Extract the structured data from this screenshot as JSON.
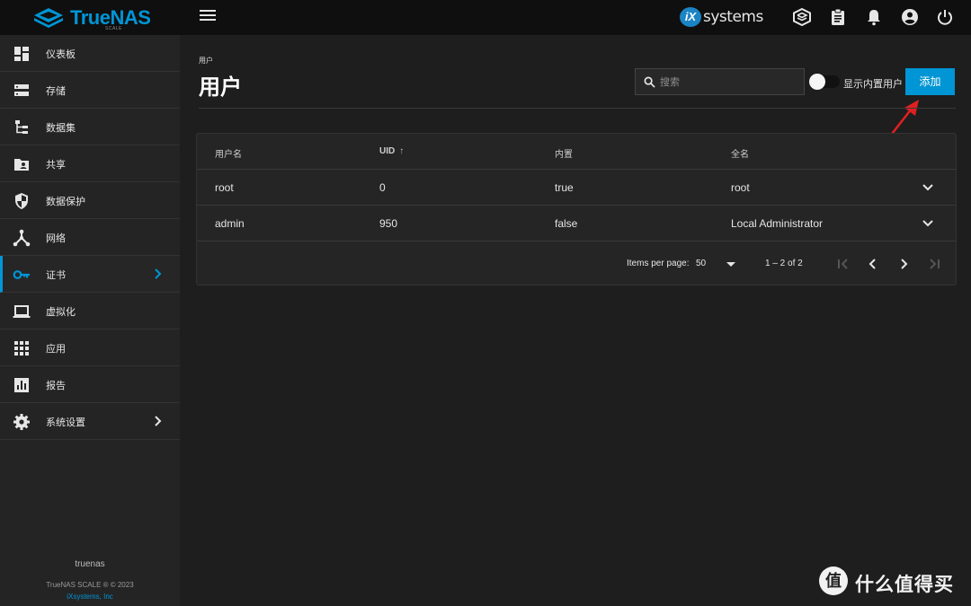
{
  "topbar": {
    "brand_name": "TrueNAS",
    "brand_sub": "SCALE",
    "vendor_logo_mark": "iX",
    "vendor_logo_text": "systems",
    "icons": [
      "truecommand-icon",
      "clipboard-icon",
      "bell-icon",
      "account-icon",
      "power-icon"
    ]
  },
  "sidebar": {
    "items": [
      {
        "label": "仪表板",
        "icon": "dashboard-icon"
      },
      {
        "label": "存储",
        "icon": "storage-icon"
      },
      {
        "label": "数据集",
        "icon": "dataset-icon"
      },
      {
        "label": "共享",
        "icon": "share-folder-icon"
      },
      {
        "label": "数据保护",
        "icon": "shield-icon"
      },
      {
        "label": "网络",
        "icon": "network-icon"
      },
      {
        "label": "证书",
        "icon": "key-icon",
        "active": true
      },
      {
        "label": "虚拟化",
        "icon": "laptop-icon"
      },
      {
        "label": "应用",
        "icon": "apps-grid-icon"
      },
      {
        "label": "报告",
        "icon": "report-chart-icon"
      },
      {
        "label": "系统设置",
        "icon": "gear-icon"
      }
    ],
    "footer": {
      "hostname": "truenas",
      "copyright": "TrueNAS SCALE ® © 2023",
      "company": "iXsystems, Inc"
    }
  },
  "main": {
    "breadcrumb": "用户",
    "title": "用户",
    "search_placeholder": "搜索",
    "toggle_label": "显示内置用户",
    "add_label": "添加",
    "table": {
      "columns": [
        "用户名",
        "UID",
        "内置",
        "全名"
      ],
      "sorted_column": "UID",
      "rows": [
        {
          "username": "root",
          "uid": "0",
          "builtin": "true",
          "fullname": "root"
        },
        {
          "username": "admin",
          "uid": "950",
          "builtin": "false",
          "fullname": "Local Administrator"
        }
      ]
    },
    "pager": {
      "items_per_page_label": "Items per page:",
      "items_per_page": "50",
      "range": "1 – 2 of 2"
    }
  },
  "watermark": {
    "mark": "值",
    "text": "什么值得买"
  },
  "colors": {
    "accent": "#0095d5",
    "topbar": "#0f0f0f",
    "sidebar": "#242424",
    "content": "#1e1e1e",
    "annotation_arrow": "#e02020"
  }
}
